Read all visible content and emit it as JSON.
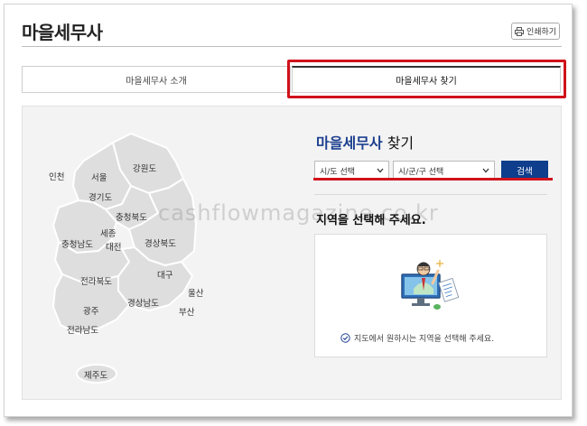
{
  "header": {
    "title": "마을세무사",
    "print_label": "인쇄하기",
    "print_icon": "printer-icon"
  },
  "tabs": [
    {
      "label": "마을세무사 소개",
      "active": false
    },
    {
      "label": "마을세무사 찾기",
      "active": true
    }
  ],
  "map": {
    "regions": [
      {
        "id": "incheon",
        "label": "인천"
      },
      {
        "id": "seoul",
        "label": "서울"
      },
      {
        "id": "gangwon",
        "label": "강원도"
      },
      {
        "id": "gyeonggi",
        "label": "경기도"
      },
      {
        "id": "chungbuk",
        "label": "충청북도"
      },
      {
        "id": "sejong",
        "label": "세종"
      },
      {
        "id": "chungnam",
        "label": "충청남도"
      },
      {
        "id": "daejeon",
        "label": "대전"
      },
      {
        "id": "gyeongbuk",
        "label": "경상북도"
      },
      {
        "id": "daegu",
        "label": "대구"
      },
      {
        "id": "jeonbuk",
        "label": "전라북도"
      },
      {
        "id": "ulsan",
        "label": "울산"
      },
      {
        "id": "gyeongnam",
        "label": "경상남도"
      },
      {
        "id": "gwangju",
        "label": "광주"
      },
      {
        "id": "busan",
        "label": "부산"
      },
      {
        "id": "jeonnam",
        "label": "전라남도"
      },
      {
        "id": "jeju",
        "label": "제주도"
      }
    ],
    "fill_color": "#dedede",
    "border_color": "#ffffff"
  },
  "finder": {
    "title_accent": "마을세무사",
    "title_rest": " 찾기",
    "sido_select": "시/도 선택",
    "sigungu_select": "시/군/구 선택",
    "search_label": "검색",
    "prompt": "지역을 선택해 주세요.",
    "hint": "지도에서 원하시는 지역을 선택해 주세요."
  },
  "watermark": "cashflowmagazine.co.kr",
  "colors": {
    "accent": "#0e3e8c",
    "highlight": "#d0121b"
  }
}
